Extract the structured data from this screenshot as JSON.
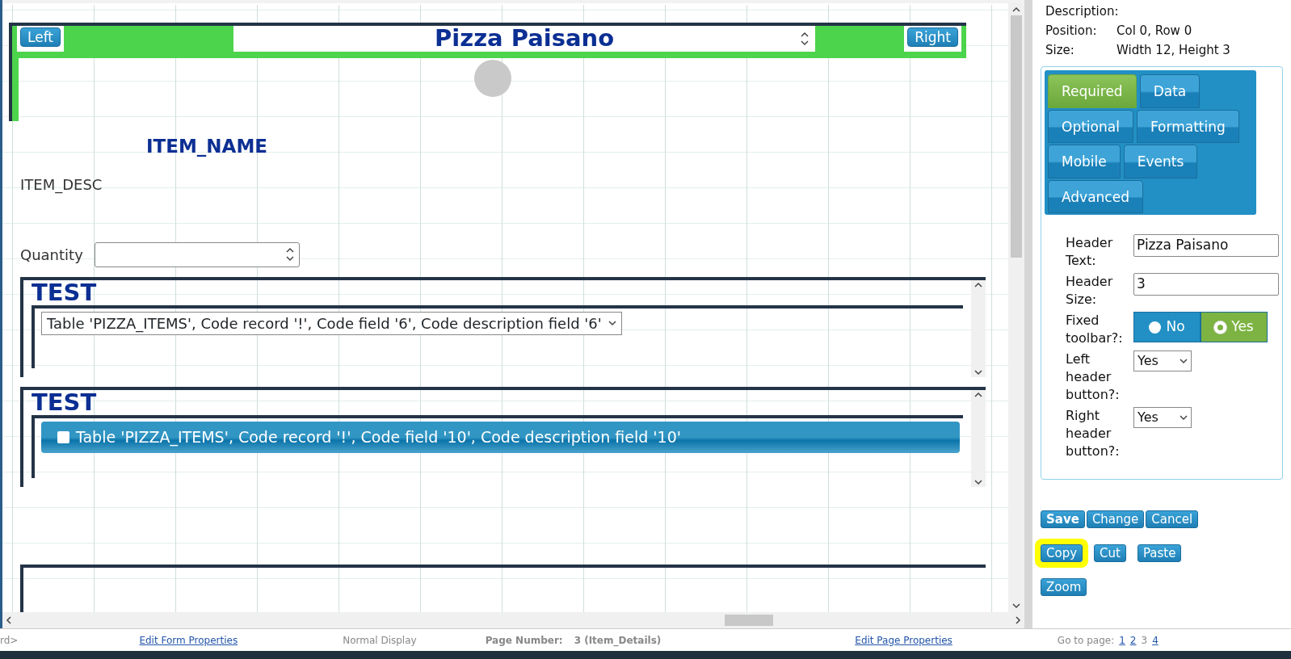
{
  "header": {
    "left_button": "Left",
    "title": "Pizza Paisano",
    "right_button": "Right"
  },
  "fields": [
    {
      "kind": "heading",
      "text": "ITEM_NAME"
    },
    {
      "kind": "text",
      "text": "ITEM_DESC"
    },
    {
      "kind": "number",
      "label": "Quantity"
    }
  ],
  "sections": [
    {
      "title": "TEST",
      "kind": "select",
      "value": "Table 'PIZZA_ITEMS', Code record '!', Code field '6', Code description field '6'"
    },
    {
      "title": "TEST",
      "kind": "checkbox",
      "label": "Table 'PIZZA_ITEMS', Code record '!', Code field '10', Code description field '10'",
      "checked": false
    }
  ],
  "properties": {
    "description_label": "Description:",
    "position_label": "Position:",
    "position": "Col 0, Row 0",
    "size_label": "Size:",
    "size": "Width 12, Height 3"
  },
  "tabs": [
    {
      "label": "Required",
      "selected": true
    },
    {
      "label": "Data",
      "selected": false
    },
    {
      "label": "Optional",
      "selected": false
    },
    {
      "label": "Formatting",
      "selected": false
    },
    {
      "label": "Mobile",
      "selected": false
    },
    {
      "label": "Events",
      "selected": false
    },
    {
      "label": "Advanced",
      "selected": false
    }
  ],
  "form": [
    {
      "kind": "text",
      "label": "Header Text:",
      "value": "Pizza Paisano"
    },
    {
      "kind": "text",
      "label": "Header Size:",
      "value": "3"
    },
    {
      "kind": "toggle",
      "label": "Fixed toolbar?:",
      "options": [
        {
          "label": "No",
          "selected": false
        },
        {
          "label": "Yes",
          "selected": true
        }
      ]
    },
    {
      "kind": "select",
      "label": "Left header button?:",
      "value": "Yes"
    },
    {
      "kind": "select",
      "label": "Right header button?:",
      "value": "Yes"
    }
  ],
  "actions": [
    [
      {
        "label": "Save",
        "default": true,
        "highlighted": false
      },
      {
        "label": "Change",
        "default": false,
        "highlighted": false
      },
      {
        "label": "Cancel",
        "default": false,
        "highlighted": false
      }
    ],
    [
      {
        "label": "Copy",
        "default": false,
        "highlighted": true
      },
      {
        "label": "Cut",
        "default": false,
        "highlighted": false
      },
      {
        "label": "Paste",
        "default": false,
        "highlighted": false
      }
    ],
    [
      {
        "label": "Zoom",
        "default": false,
        "highlighted": false
      }
    ]
  ],
  "status_bar": {
    "cut_text": "rd>",
    "edit_form": "Edit Form Properties",
    "display": "Normal Display",
    "page_label": "Page Number:",
    "page_value": "3 (Item_Details)",
    "edit_page": "Edit Page Properties",
    "goto_label": "Go to page:",
    "pages": [
      {
        "label": "1",
        "selected": false
      },
      {
        "label": "2",
        "selected": false
      },
      {
        "label": "3",
        "selected": true
      },
      {
        "label": "4",
        "selected": false
      }
    ]
  }
}
